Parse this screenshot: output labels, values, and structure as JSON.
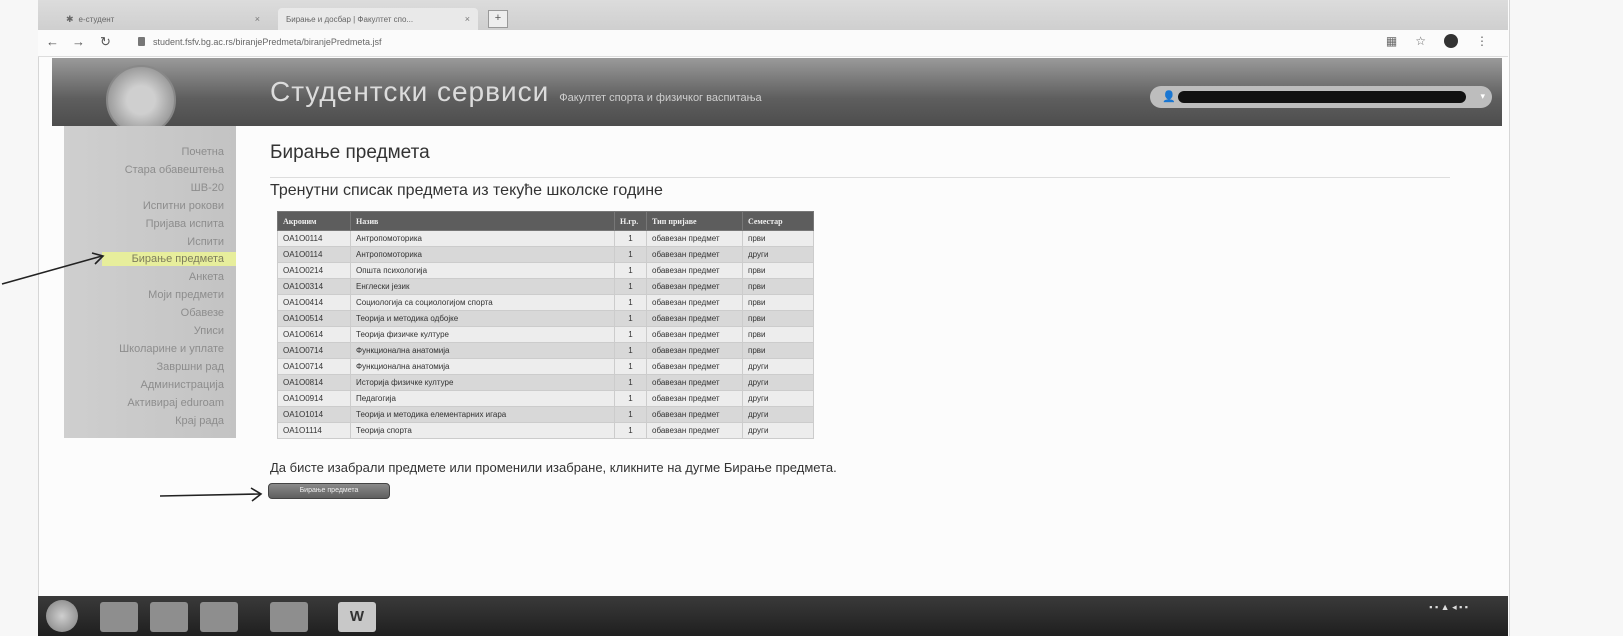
{
  "browser": {
    "tab1_title": "e-студент",
    "tab2_title": "Бирање и досбар | Факултет спо...",
    "url": "student.fsfv.bg.ac.rs/biranjePredmeta/biranjePredmeta.jsf"
  },
  "header": {
    "title": "Студентски сервиси",
    "subtitle": "Факултет спорта и физичког васпитања"
  },
  "sidebar": {
    "items": [
      {
        "label": "Почетна"
      },
      {
        "label": "Стара обавештења"
      },
      {
        "label": "ШВ-20"
      },
      {
        "label": "Испитни рокови"
      },
      {
        "label": "Пријава испита"
      },
      {
        "label": "Испити"
      },
      {
        "label": "Бирање предмета"
      },
      {
        "label": "Анкета"
      },
      {
        "label": "Моји предмети"
      },
      {
        "label": "Обавезе"
      },
      {
        "label": "Уписи"
      },
      {
        "label": "Школарине и уплате"
      },
      {
        "label": "Завршни рад"
      },
      {
        "label": "Администрација"
      },
      {
        "label": "Активирај eduroam"
      },
      {
        "label": "Крај рада"
      }
    ]
  },
  "main": {
    "page_title": "Бирање предмета",
    "subtitle": "Тренутни списак предмета из текуће школске године",
    "instruction": "Да бисте изабрали предмете или променили изабране, кликните на дугме Бирање предмета.",
    "select_button": "Бирање предмета"
  },
  "table": {
    "headers": [
      "Акроним",
      "Назив",
      "Н.гр.",
      "Тип пријаве",
      "Семестар"
    ],
    "rows": [
      [
        "OA1O0114",
        "Антропомоторика",
        "1",
        "обавезан предмет",
        "први"
      ],
      [
        "OA1O0114",
        "Антропомоторика",
        "1",
        "обавезан предмет",
        "други"
      ],
      [
        "OA1O0214",
        "Општа психологија",
        "1",
        "обавезан предмет",
        "први"
      ],
      [
        "OA1O0314",
        "Енглески језик",
        "1",
        "обавезан предмет",
        "први"
      ],
      [
        "OA1O0414",
        "Социологија са социологијом спорта",
        "1",
        "обавезан предмет",
        "први"
      ],
      [
        "OA1O0514",
        "Теорија и методика одбојке",
        "1",
        "обавезан предмет",
        "први"
      ],
      [
        "OA1O0614",
        "Теорија физичке културе",
        "1",
        "обавезан предмет",
        "први"
      ],
      [
        "OA1O0714",
        "Функционална анатомија",
        "1",
        "обавезан предмет",
        "први"
      ],
      [
        "OA1O0714",
        "Функционална анатомија",
        "1",
        "обавезан предмет",
        "други"
      ],
      [
        "OA1O0814",
        "Историја физичке културе",
        "1",
        "обавезан предмет",
        "други"
      ],
      [
        "OA1O0914",
        "Педагогија",
        "1",
        "обавезан предмет",
        "други"
      ],
      [
        "OA1O1014",
        "Теорија и методика елементарних игара",
        "1",
        "обавезан предмет",
        "други"
      ],
      [
        "OA1O1114",
        "Теорија спорта",
        "1",
        "обавезан предмет",
        "други"
      ]
    ]
  }
}
